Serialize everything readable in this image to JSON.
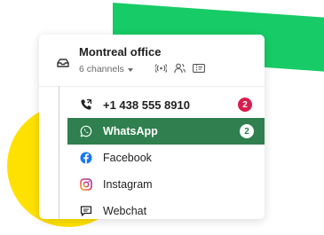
{
  "inbox": {
    "title": "Montreal office",
    "channels_label": "6 channels",
    "header_icons": [
      "broadcast-icon",
      "people-icon",
      "ticket-icon"
    ]
  },
  "channels": [
    {
      "label": "+1 438 555 8910",
      "icon": "phone-icon",
      "badge": "2",
      "badge_color": "#d81e4e"
    },
    {
      "label": "WhatsApp",
      "icon": "whatsapp-icon",
      "badge": "2",
      "badge_color": "#ffffff",
      "selected": true
    },
    {
      "label": "Facebook",
      "icon": "facebook-icon"
    },
    {
      "label": "Instagram",
      "icon": "instagram-icon"
    },
    {
      "label": "Webchat",
      "icon": "chat-icon"
    }
  ],
  "colors": {
    "accent_green": "#17cc66",
    "selected_green": "#2f7f4f",
    "badge_red": "#d81e4e",
    "yellow": "#ffe100",
    "facebook_blue": "#1877f2",
    "instagram_pink": "#e1306c"
  }
}
